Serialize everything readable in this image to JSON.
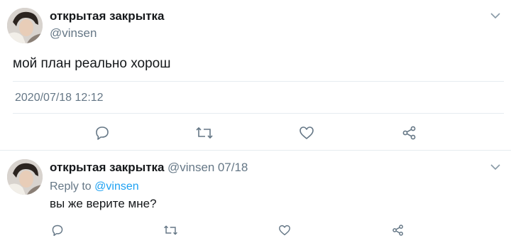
{
  "main_tweet": {
    "author_name": "открытая закрытка",
    "author_handle": "@vinsen",
    "text": "мой план реально хорош",
    "timestamp": "2020/07/18 12:12",
    "menu_icon": "chevron-down-icon",
    "actions": [
      "reply-icon",
      "retweet-icon",
      "like-icon",
      "share-icon"
    ]
  },
  "reply_tweet": {
    "author_name": "открытая закрытка",
    "author_handle": "@vinsen",
    "date": "07/18",
    "reply_to_prefix": "Reply to",
    "reply_to_handle": "@vinsen",
    "text": "вы же верите мне?",
    "menu_icon": "chevron-down-icon",
    "actions": [
      "reply-icon",
      "retweet-icon",
      "like-icon",
      "share-icon"
    ]
  },
  "colors": {
    "text": "#14171a",
    "secondary": "#657786",
    "link": "#1da1f2",
    "divider": "#e6ecf0",
    "icon": "#657786"
  }
}
